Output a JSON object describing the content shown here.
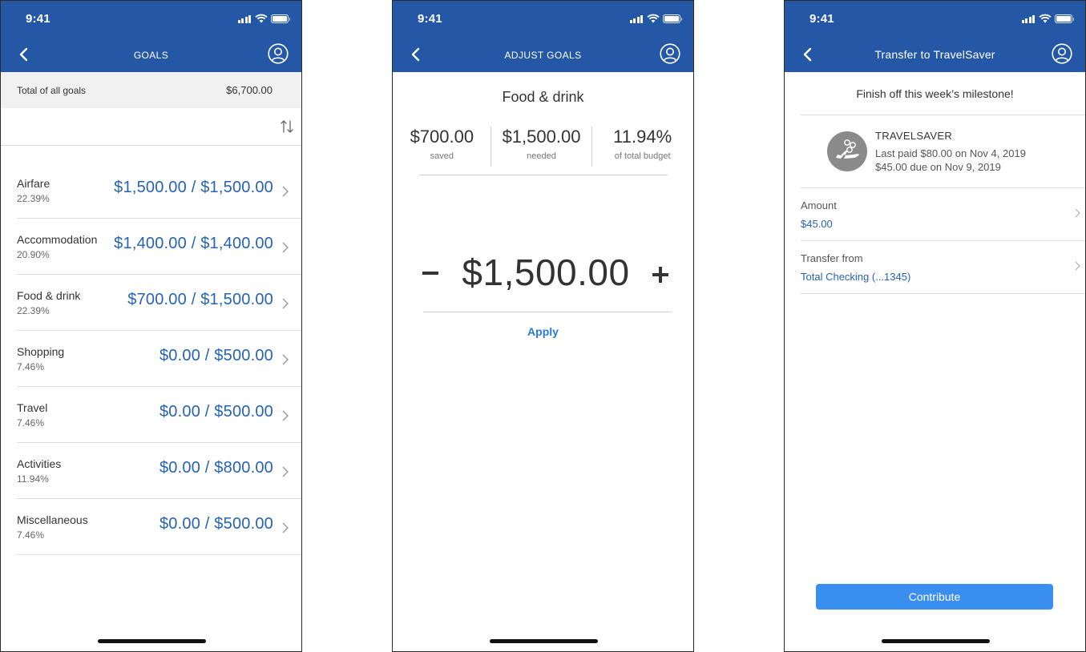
{
  "status": {
    "time": "9:41"
  },
  "goals_screen": {
    "title": "GOALS",
    "total_label": "Total of all goals",
    "total_value": "$6,700.00",
    "items": [
      {
        "name": "Airfare",
        "percent": "22.39%",
        "amount": "$1,500.00 / $1,500.00"
      },
      {
        "name": "Accommodation",
        "percent": "20.90%",
        "amount": "$1,400.00 / $1,400.00"
      },
      {
        "name": "Food & drink",
        "percent": "22.39%",
        "amount": "$700.00 / $1,500.00"
      },
      {
        "name": "Shopping",
        "percent": "7.46%",
        "amount": "$0.00 / $500.00"
      },
      {
        "name": "Travel",
        "percent": "7.46%",
        "amount": "$0.00 / $500.00"
      },
      {
        "name": "Activities",
        "percent": "11.94%",
        "amount": "$0.00 / $800.00"
      },
      {
        "name": "Miscellaneous",
        "percent": "7.46%",
        "amount": "$0.00 / $500.00"
      }
    ]
  },
  "adjust_screen": {
    "title": "ADJUST GOALS",
    "goal_name": "Food & drink",
    "saved_value": "$700.00",
    "saved_label": "saved",
    "needed_value": "$1,500.00",
    "needed_label": "needed",
    "budget_value": "11.94%",
    "budget_label": "of total budget",
    "amount": "$1,500.00",
    "apply_label": "Apply"
  },
  "transfer_screen": {
    "title": "Transfer to TravelSaver",
    "milestone": "Finish off this week’s milestone!",
    "account_name": "TRAVELSAVER",
    "last_paid": "Last paid $80.00 on Nov 4, 2019",
    "due": "$45.00 due on Nov 9, 2019",
    "amount_label": "Amount",
    "amount_value": "$45.00",
    "from_label": "Transfer from",
    "from_value": "Total Checking (...1345)",
    "contribute_label": "Contribute"
  },
  "colors": {
    "nav_bar": "#2458a6",
    "link_blue": "#2563b3",
    "button_blue": "#3a8ef0"
  }
}
